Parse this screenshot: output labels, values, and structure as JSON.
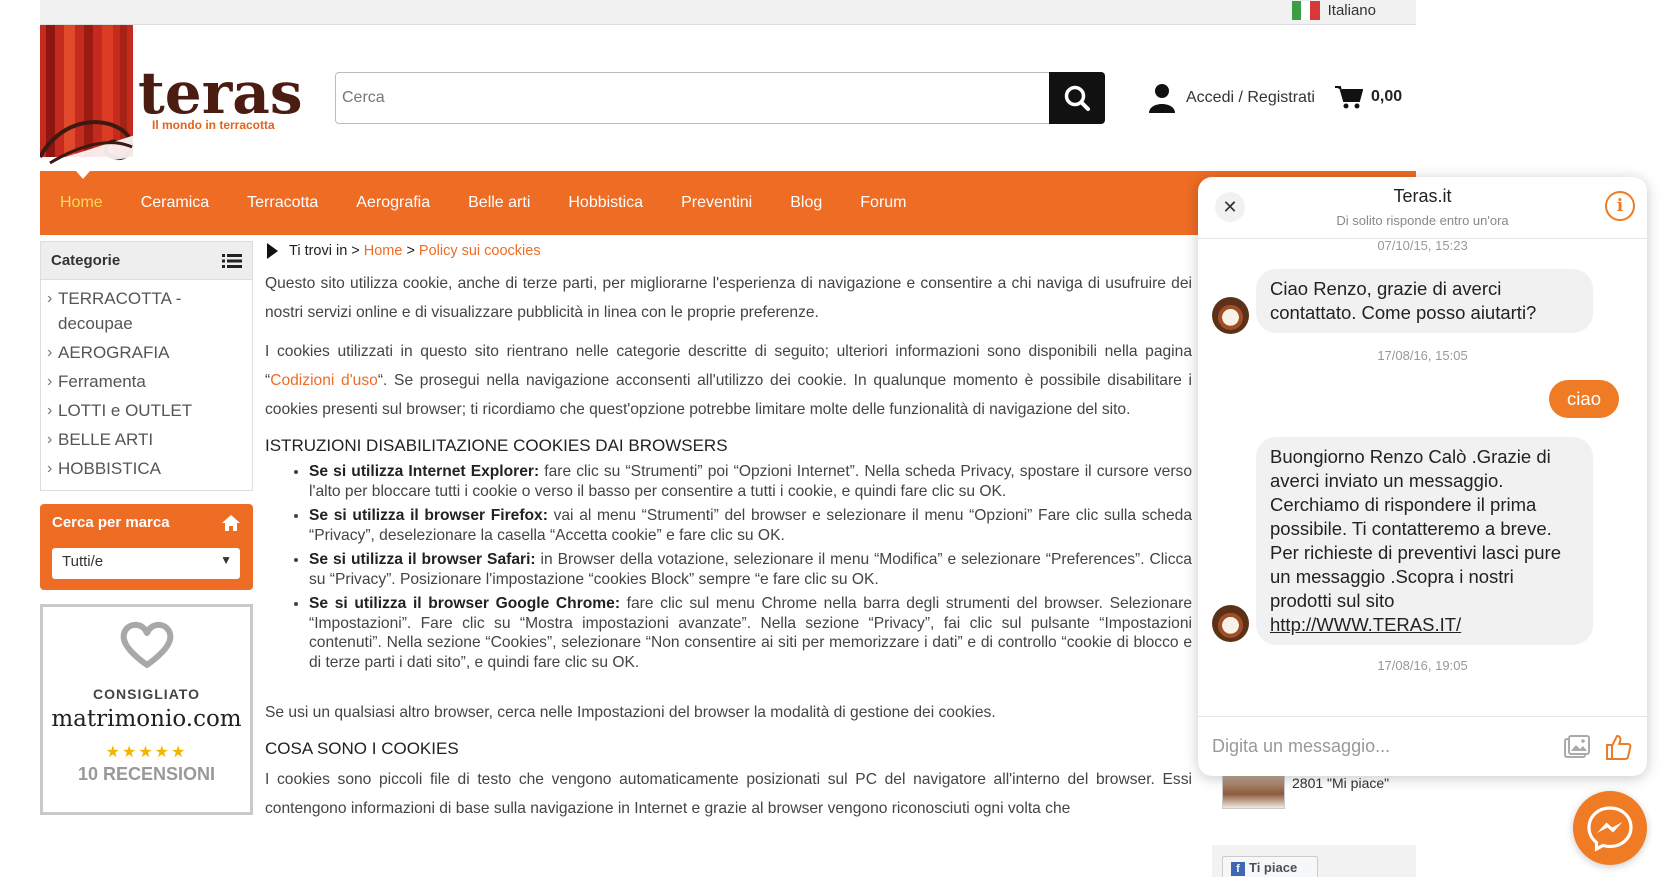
{
  "topbar": {
    "language": "Italiano"
  },
  "brand": {
    "name": "teras",
    "tagline": "Il mondo in terracotta"
  },
  "search": {
    "placeholder": "Cerca"
  },
  "account": {
    "label": "Accedi / Registrati"
  },
  "cart": {
    "total": "0,00"
  },
  "nav": {
    "items": [
      {
        "label": "Home"
      },
      {
        "label": "Ceramica"
      },
      {
        "label": "Terracotta"
      },
      {
        "label": "Aerografia"
      },
      {
        "label": "Belle arti"
      },
      {
        "label": "Hobbistica"
      },
      {
        "label": "Preventini"
      },
      {
        "label": "Blog"
      },
      {
        "label": "Forum"
      }
    ],
    "active_color": "#ffd85a",
    "bar_color": "#ee6c24"
  },
  "sidebar": {
    "categories_title": "Categorie",
    "categories": [
      {
        "label": "TERRACOTTA - decoupae"
      },
      {
        "label": "AEROGRAFIA"
      },
      {
        "label": "Ferramenta"
      },
      {
        "label": "LOTTI e OUTLET"
      },
      {
        "label": "BELLE ARTI"
      },
      {
        "label": "HOBBISTICA"
      }
    ],
    "brand_filter": {
      "title": "Cerca per marca",
      "selected": "Tutti/e"
    },
    "badge": {
      "recommended": "CONSIGLIATO",
      "site": "matrimonio.com",
      "stars": "★★★★★",
      "reviews": "10 RECENSIONI"
    }
  },
  "main": {
    "breadcrumb": {
      "prefix": "Ti trovi in",
      "sep1": ">",
      "home": "Home",
      "sep2": ">",
      "current": "Policy sui coockies"
    },
    "p1": "Questo sito utilizza cookie, anche di terze parti, per migliorarne l'esperienza di navigazione e consentire a chi naviga di usufruire dei nostri servizi online e di visualizzare pubblicità in linea con le proprie preferenze.",
    "p2_before": "I cookies utilizzati in questo sito rientrano nelle categorie descritte di seguito; ulteriori informazioni sono disponibili nella pagina “",
    "p2_link": "Codizioni d'uso",
    "p2_after": "“. Se prosegui nella navigazione acconsenti all'utilizzo dei cookie. In qualunque momento è possibile disabilitare i cookies presenti sul browser; ti ricordiamo che quest'opzione potrebbe limitare molte delle funzionalità di navigazione del sito.",
    "h_browsers": "ISTRUZIONI DISABILITAZIONE COOKIES DAI BROWSERS",
    "browsers": [
      {
        "lead": "Se si utilizza Internet Explorer:",
        "text": " fare clic su “Strumenti” poi “Opzioni Internet”. Nella scheda Privacy, spostare il cursore verso l'alto per bloccare tutti i cookie o verso il basso per consentire a tutti i cookie, e quindi fare clic su OK."
      },
      {
        "lead": "Se si utilizza il browser Firefox:",
        "text": " vai al menu “Strumenti” del browser e selezionare il menu “Opzioni” Fare clic sulla scheda “Privacy”, deselezionare la casella “Accetta cookie” e fare clic su OK."
      },
      {
        "lead": "Se si utilizza il browser Safari:",
        "text": " in Browser della votazione, selezionare il menu “Modifica” e selezionare “Preferences”. Clicca su “Privacy”. Posizionare l'impostazione “cookies Block” sempre “e fare clic su OK."
      },
      {
        "lead": "Se si utilizza il browser Google Chrome:",
        "text": " fare clic sul menu Chrome nella barra degli strumenti del browser. Selezionare “Impostazioni”. Fare clic su “Mostra impostazioni avanzate”. Nella sezione “Privacy”, fai clic sul pulsante “Impostazioni contenuti”. Nella sezione “Cookies”, selezionare “Non consentire ai siti per memorizzare i dati” e di controllo “cookie di blocco e di terze parti i dati sito”, e quindi fare clic su OK."
      }
    ],
    "p_other": "Se usi un qualsiasi altro browser, cerca nelle Impostazioni del browser la modalità di gestione dei cookies.",
    "h_what": "COSA SONO I COOKIES",
    "p_what": "I cookies sono piccoli file di testo che vengono automaticamente posizionati sul PC del navigatore all'interno del browser. Essi contengono informazioni di base sulla navigazione in Internet e grazie al browser vengono riconosciuti ogni volta che"
  },
  "chat": {
    "name": "Teras.it",
    "subtitle": "Di solito risponde entro un'ora",
    "info_glyph": "i",
    "ts1": "07/10/15, 15:23",
    "msg1": "Ciao Renzo, grazie di averci contattato. Come posso aiutarti?",
    "ts2": "17/08/16, 15:05",
    "msg_out": "ciao",
    "msg2": "Buongiorno Renzo Calò .Grazie di averci inviato un messaggio. Cerchiamo di rispondere il prima possibile. Ti contatteremo a breve. Per richieste di preventivi lasci pure un messaggio .Scopra i nostri prodotti sul sito",
    "msg2_link": "http://WWW.TERAS.IT/",
    "ts3": "17/08/16, 19:05",
    "input_placeholder": "Digita un messaggio...",
    "accent": "#f07b25"
  },
  "facebook": {
    "likes": "2801 \"Mi piace\"",
    "like_button": "Ti piace"
  }
}
